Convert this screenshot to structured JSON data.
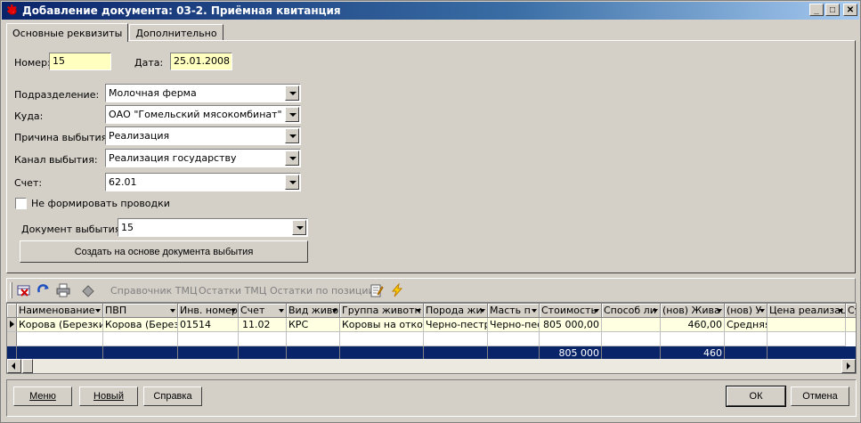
{
  "window": {
    "title": "Добавление документа: 03-2. Приёмная квитанция",
    "min": "_",
    "max": "□",
    "close": "✕"
  },
  "tabs": [
    "Основные реквизиты",
    "Дополнительно"
  ],
  "form": {
    "number_label": "Номер:",
    "number_value": "15",
    "date_label": "Дата:",
    "date_value": "25.01.2008",
    "division_label": "Подразделение:",
    "division_value": "Молочная ферма",
    "dest_label": "Куда:",
    "dest_value": "ОАО \"Гомельский мясокомбинат\"",
    "reason_label": "Причина выбытия:",
    "reason_value": "Реализация",
    "channel_label": "Канал выбытия:",
    "channel_value": "Реализация государству",
    "account_label": "Счет:",
    "account_value": "62.01",
    "no_postings_label": "Не формировать проводки",
    "disposal_doc_label": "Документ выбытия:",
    "disposal_doc_value": "15",
    "create_button": "Создать на основе документа выбытия"
  },
  "toolbar": {
    "ref_tmc": "Справочник ТМЦ",
    "rest_tmc": "Остатки ТМЦ",
    "rest_pos": "Остатки по позиции"
  },
  "grid": {
    "columns": [
      "Наименование",
      "ПВП",
      "Инв. номер",
      "Счет",
      "Вид живо",
      "Группа животн",
      "Порода жи",
      "Масть п",
      "Стоимость",
      "Способ ли",
      "(нов) Жива",
      "(нов) У",
      "Цена реализац",
      "Су"
    ],
    "row": [
      "Корова (Березки)",
      "Корова (Березки)",
      "01514",
      "11.02",
      "КРС",
      "Коровы на откорм",
      "Черно-пестра",
      "Черно-пест",
      "805 000,00",
      "",
      "460,00",
      "Средняя",
      "",
      ""
    ],
    "totals": {
      "cost": "805 000",
      "weight": "460"
    }
  },
  "buttons": {
    "menu": "Меню",
    "new": "Новый",
    "help": "Справка",
    "ok": "ОК",
    "cancel": "Отмена"
  }
}
